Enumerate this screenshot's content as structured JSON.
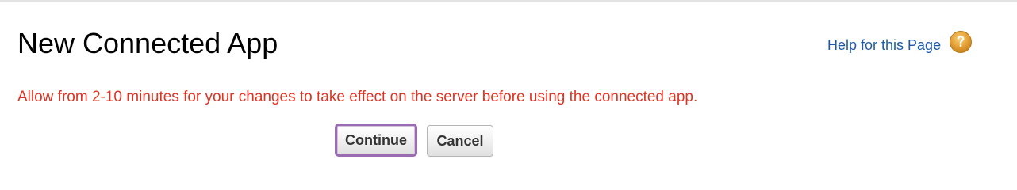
{
  "page": {
    "title": "New Connected App",
    "help_link_label": "Help for this Page",
    "help_icon": "question-mark-circle-icon",
    "message": "Allow from 2-10 minutes for your changes to take effect on the server before using the connected app."
  },
  "actions": {
    "continue_label": "Continue",
    "cancel_label": "Cancel"
  },
  "colors": {
    "message_text": "#e23322",
    "help_link_text": "#1f5aa6",
    "help_icon_fill": "#e8a53b",
    "focused_button_border": "#9a6bb0"
  }
}
